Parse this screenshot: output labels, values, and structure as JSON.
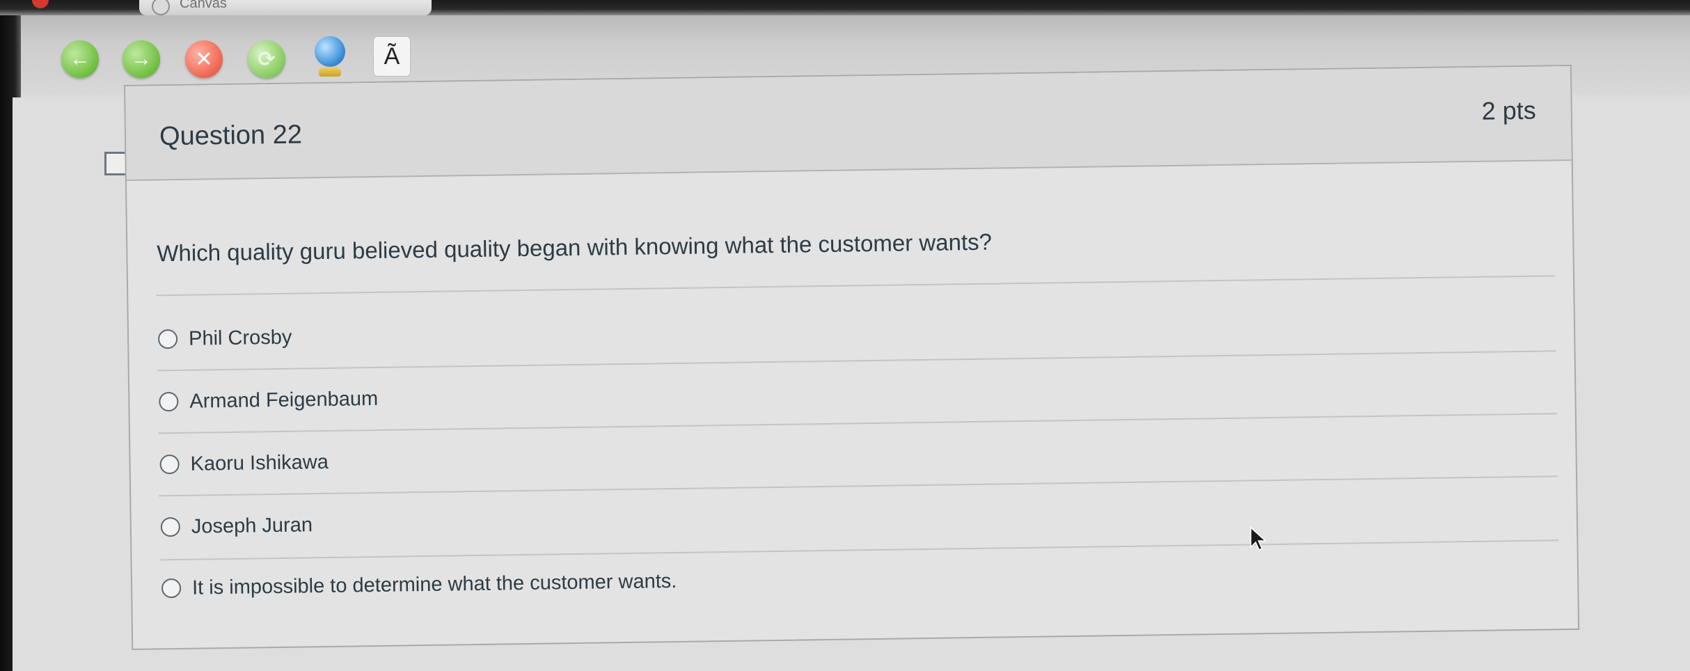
{
  "browser": {
    "tab_title": "Canvas",
    "toolbar": {
      "back_icon": "arrow-left-icon",
      "forward_icon": "arrow-right-icon",
      "stop_icon": "close-icon",
      "reload_icon": "refresh-icon",
      "home_icon": "globe-icon",
      "font_glyph": "Ã"
    }
  },
  "question": {
    "title": "Question 22",
    "points": "2 pts",
    "prompt": "Which quality guru believed quality began with knowing what the customer wants?",
    "answers": [
      {
        "label": "Phil Crosby",
        "selected": false
      },
      {
        "label": "Armand Feigenbaum",
        "selected": false
      },
      {
        "label": "Kaoru Ishikawa",
        "selected": false
      },
      {
        "label": "Joseph Juran",
        "selected": false
      },
      {
        "label": "It is impossible to determine what the customer wants.",
        "selected": false
      }
    ]
  },
  "colors": {
    "text": "#2d3b45",
    "card_bg": "#e3e3e3",
    "header_bg": "#d9d9d9",
    "border": "#a9a9a9"
  }
}
